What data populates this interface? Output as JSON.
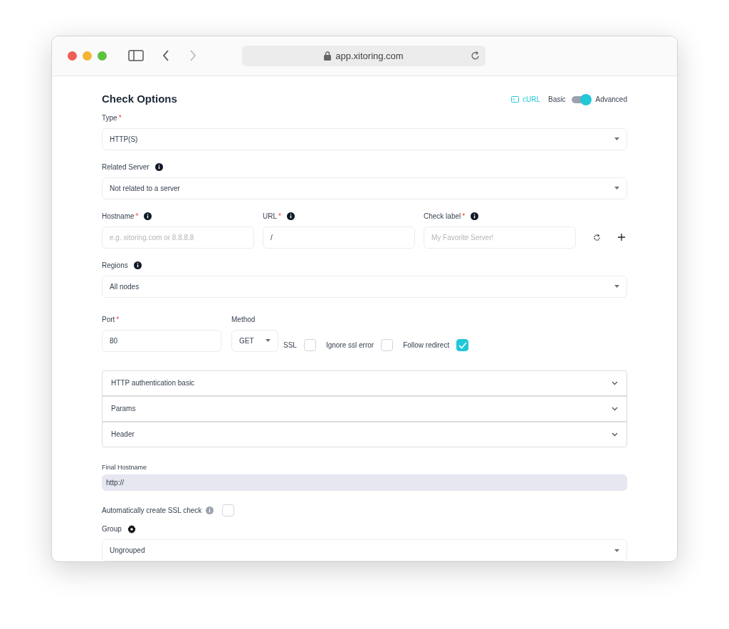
{
  "browser": {
    "address": "app.xitoring.com"
  },
  "header": {
    "title": "Check Options",
    "curl": "cURL",
    "mode_left": "Basic",
    "mode_right": "Advanced",
    "advanced": true
  },
  "type": {
    "label": "Type",
    "required_mark": "*",
    "value": "HTTP(S)"
  },
  "related_server": {
    "label": "Related Server",
    "value": "Not related to a server"
  },
  "hostname": {
    "label": "Hostname",
    "required_mark": "*",
    "placeholder": "e.g. xitoring.com or 8.8.8.8"
  },
  "url": {
    "label": "URL",
    "required_mark": "*",
    "value": "/"
  },
  "check_label": {
    "label": "Check label",
    "required_mark": "*",
    "placeholder": "My Favorite Server!"
  },
  "regions": {
    "label": "Regions",
    "value": "All nodes"
  },
  "port": {
    "label": "Port",
    "required_mark": "*",
    "value": "80"
  },
  "method": {
    "label": "Method",
    "value": "GET"
  },
  "options": [
    {
      "label": "SSL",
      "checked": false
    },
    {
      "label": "Ignore ssl error",
      "checked": false
    },
    {
      "label": "Follow redirect",
      "checked": true
    }
  ],
  "accordions": [
    {
      "label": "HTTP authentication basic",
      "expanded": false
    },
    {
      "label": "Params",
      "expanded": false
    },
    {
      "label": "Header",
      "expanded": false
    }
  ],
  "final_hostname": {
    "label": "Final Hostname",
    "value": "http://"
  },
  "auto_ssl": {
    "label": "Automatically create SSL check",
    "checked": false
  },
  "group": {
    "label": "Group",
    "value": "Ungrouped"
  }
}
